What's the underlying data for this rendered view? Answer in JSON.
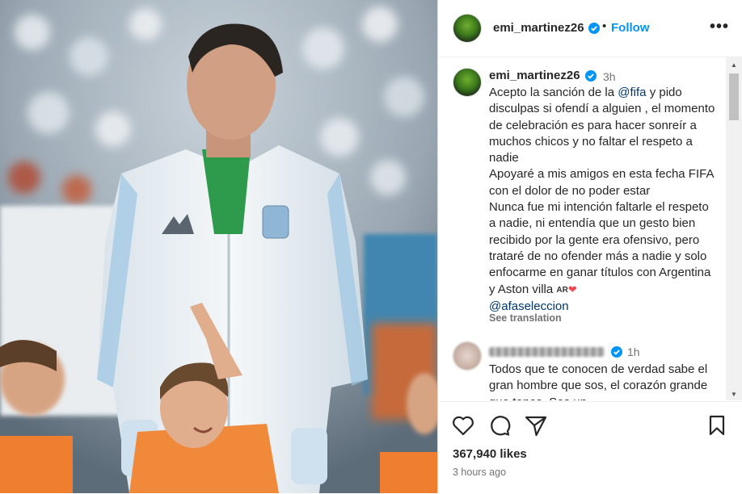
{
  "header": {
    "username": "emi_martinez26",
    "separator": "•",
    "follow_label": "Follow",
    "more_label": "•••"
  },
  "caption": {
    "username": "emi_martinez26",
    "time": "3h",
    "part1": "Acepto la sanción de la ",
    "mention1": "@fifa",
    "part2": " y pido disculpas si ofendí a alguien , el momento de celebración es para hacer sonreír a muchos chicos y no faltar el respeto a nadie\nApoyaré a mis amigos en esta fecha FIFA con el dolor de no poder estar\nNunca fue mi intención faltarle el respeto a nadie, ni entendía que un gesto bien recibido por la gente era ofensivo, pero trataré de no ofender más a nadie y solo enfocarme en ganar títulos con Argentina y Aston villa ",
    "flag": "AR",
    "heart": "❤",
    "mention2": "@afaseleccion",
    "see_translation": "See translation"
  },
  "comment2": {
    "time": "1h",
    "text": "Todos que te conocen de verdad sabe el gran hombre que sos, el corazón grande que tenes. Sos un"
  },
  "actions": {
    "likes": "367,940 likes",
    "posted": "3 hours ago"
  },
  "icons": [
    "verified-badge-icon",
    "more-options-icon",
    "heart-icon",
    "comment-icon",
    "share-icon",
    "bookmark-icon",
    "scroll-up-icon",
    "scroll-down-icon"
  ],
  "colors": {
    "link": "#0095f6",
    "mention": "#00376b",
    "verified": "#0095f6",
    "muted": "#737373"
  },
  "scroll": {
    "thumb_position": 0.05
  }
}
